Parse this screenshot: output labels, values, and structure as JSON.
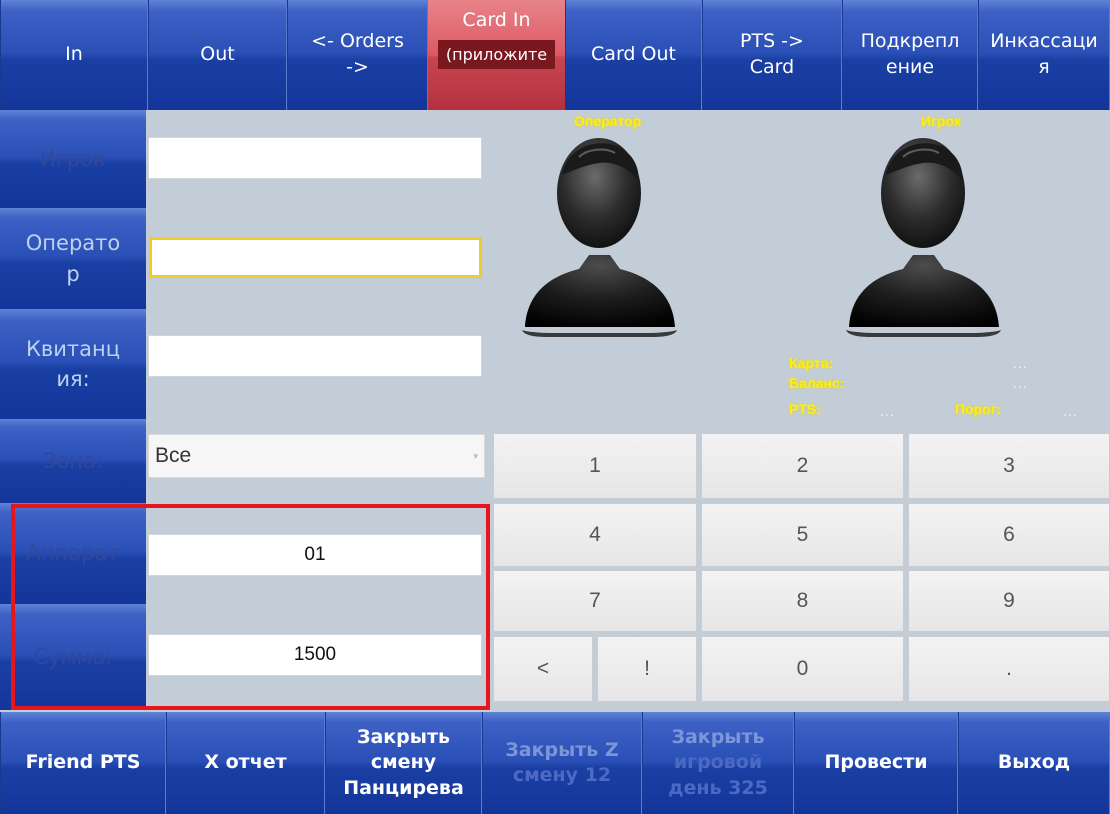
{
  "top_nav": {
    "tabs": [
      {
        "label": "In",
        "sub": ""
      },
      {
        "label": "Out",
        "sub": ""
      },
      {
        "label": "<- Orders\n->",
        "sub": ""
      },
      {
        "label": "Card In",
        "sub": "(приложите"
      },
      {
        "label": "Card Out",
        "sub": ""
      },
      {
        "label": "PTS ->\nCard",
        "sub": ""
      },
      {
        "label": "Подкрепл\nение",
        "sub": ""
      },
      {
        "label": "Инкассаци\nя",
        "sub": ""
      }
    ],
    "active_tab": "Card In"
  },
  "form": {
    "player_label": "Игрок",
    "player_value": "",
    "operator_label": "Операто\nр",
    "operator_value": "",
    "receipt_label": "Квитанц\nия:",
    "receipt_value": "",
    "zone_label": "Зона:",
    "zone_value": "Все",
    "machine_label": "Аппарат",
    "machine_value": "01",
    "amount_label": "Сумма:",
    "amount_value": "1500"
  },
  "avatars": {
    "operator_caption": "Оператор",
    "player_caption": "Игрок"
  },
  "card_info": {
    "card_label": "Карта:",
    "card_value": "...",
    "balance_label": "Баланс:",
    "balance_value": "...",
    "pts_label": "PTS:",
    "pts_value": "...",
    "threshold_label": "Порог:",
    "threshold_value": "..."
  },
  "keypad": {
    "keys": [
      "1",
      "2",
      "3",
      "4",
      "5",
      "6",
      "7",
      "8",
      "9",
      "<",
      "!",
      "0",
      "."
    ]
  },
  "bottom_bar": {
    "buttons": [
      {
        "label": "Friend PTS",
        "enabled": true
      },
      {
        "label": "X отчет",
        "enabled": true
      },
      {
        "label": "Закрыть\nсмену\nПанцирева",
        "enabled": true
      },
      {
        "label_line1": "Закрыть Z",
        "label_line2": "смену 12",
        "enabled": false
      },
      {
        "label_line1": "Закрыть",
        "label_line2": "игровой",
        "label_line3": "день 325",
        "enabled": false
      },
      {
        "label": "Провести",
        "enabled": true
      },
      {
        "label": "Выход",
        "enabled": true
      }
    ]
  },
  "colors": {
    "nav_blue": "#2a4fb6",
    "active_red": "#db5a64",
    "panel_bg": "#c3cdd7",
    "label_yellow": "#ffee10",
    "highlight_red": "#e7151e",
    "focus_yellow": "#f0cc25"
  },
  "icons": [
    "operator-avatar-icon",
    "player-avatar-icon",
    "dropdown-caret-icon"
  ]
}
